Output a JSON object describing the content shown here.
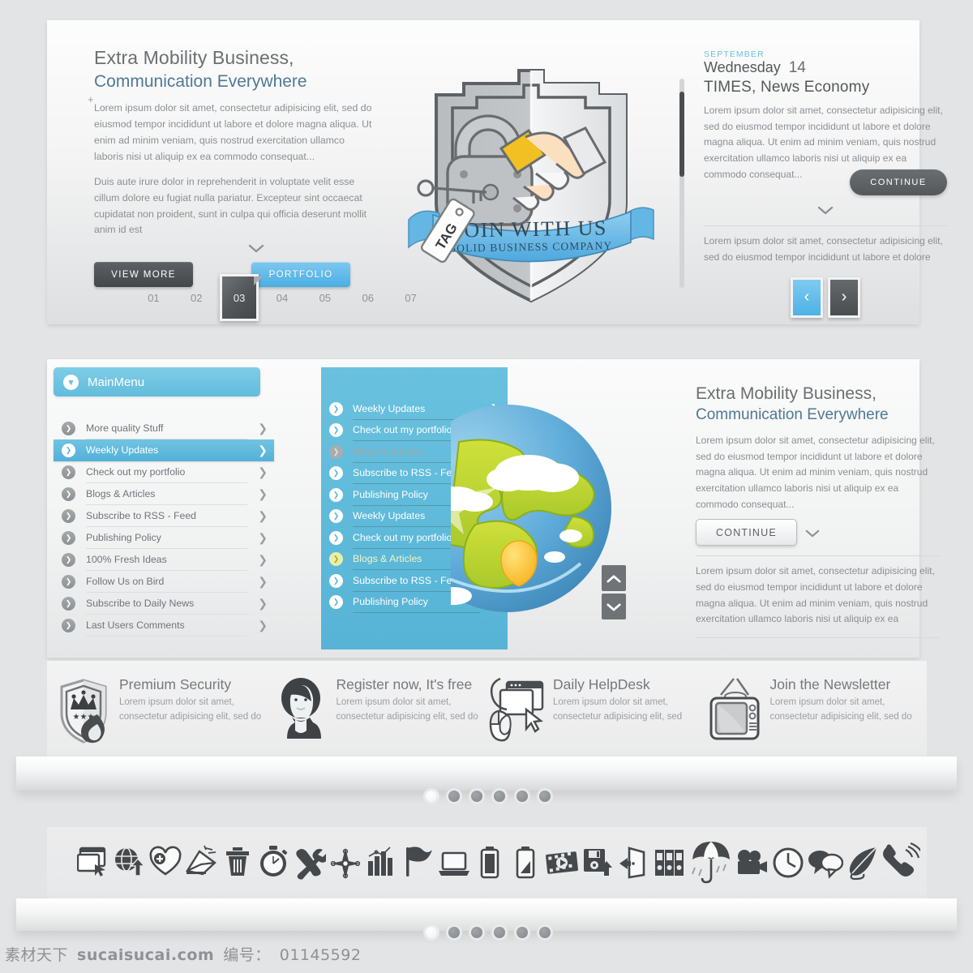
{
  "hero": {
    "title_line1": "Extra Mobility Business,",
    "title_line2": "Communication Everywhere",
    "plus": "+",
    "para1": "Lorem ipsum dolor sit amet, consectetur adipisicing elit, sed do eiusmod tempor incididunt ut labore et dolore magna aliqua. Ut enim ad minim veniam, quis nostrud exercitation ullamco laboris nisi ut aliquip ex ea commodo consequat...",
    "para2": "Duis aute irure dolor in reprehenderit in voluptate velit esse cillum dolore eu fugiat nulla pariatur. Excepteur sint occaecat cupidatat non proident, sunt in culpa qui officia deserunt mollit anim id est",
    "view_more_label": "VIEW MORE",
    "portfolio_label": "PORTFOLIO",
    "carousel": [
      "01",
      "02",
      "03",
      "04",
      "05",
      "06",
      "07"
    ],
    "carousel_active": "03",
    "badge": {
      "ribbon_line1": "JOIN WITH US",
      "ribbon_line2": "SOLID BUSINESS COMPANY",
      "tag_label": "TAG"
    }
  },
  "news": {
    "month": "SEPTEMBER",
    "weekday": "Wednesday",
    "day": "14",
    "headline": "TIMES, News Economy",
    "para": "Lorem ipsum dolor sit amet, consectetur adipisicing elit, sed do eiusmod tempor incididunt ut labore et dolore magna aliqua. Ut enim ad minim veniam, quis nostrud exercitation ullamco laboris nisi ut aliquip ex ea commodo consequat...",
    "continue_label": "CONTINUE",
    "footer_para": "Lorem ipsum dolor sit amet, consectetur adipisicing elit, sed do eiusmod tempor incididunt ut labore et dolore",
    "prev_label": "‹",
    "next_label": "›"
  },
  "menu": {
    "header_label": "MainMenu",
    "items": [
      {
        "label": "More quality Stuff",
        "state": "normal"
      },
      {
        "label": "Weekly Updates",
        "state": "active"
      },
      {
        "label": "Check out my portfolio",
        "state": "normal"
      },
      {
        "label": "Blogs & Articles",
        "state": "normal"
      },
      {
        "label": "Subscribe to RSS - Feed",
        "state": "normal"
      },
      {
        "label": "Publishing Policy",
        "state": "normal"
      },
      {
        "label": "100% Fresh Ideas",
        "state": "normal"
      },
      {
        "label": "Follow Us on Bird",
        "state": "normal"
      },
      {
        "label": "Subscribe to Daily News",
        "state": "normal"
      },
      {
        "label": "Last Users Comments",
        "state": "normal"
      }
    ]
  },
  "submenu": {
    "items": [
      {
        "label": "Weekly Updates",
        "state": "normal"
      },
      {
        "label": "Check out my portfolio",
        "state": "normal"
      },
      {
        "label": "Blogs & Articles",
        "state": "dim"
      },
      {
        "label": "Subscribe to RSS - Feed",
        "state": "normal"
      },
      {
        "label": "Publishing Policy",
        "state": "normal"
      },
      {
        "label": "Weekly Updates",
        "state": "normal"
      },
      {
        "label": "Check out my portfolio",
        "state": "normal"
      },
      {
        "label": "Blogs & Articles",
        "state": "highlight"
      },
      {
        "label": "Subscribe to RSS - Feed",
        "state": "normal"
      },
      {
        "label": "Publishing Policy",
        "state": "normal"
      }
    ]
  },
  "menu_right": {
    "title_line1": "Extra Mobility Business,",
    "title_line2": "Communication Everywhere",
    "para1": "Lorem ipsum dolor sit amet, consectetur adipisicing elit, sed do eiusmod tempor incididunt ut labore et dolore magna aliqua. Ut enim ad minim veniam, quis nostrud exercitation ullamco laboris nisi ut aliquip ex ea commodo consequat...",
    "continue_label": "CONTINUE",
    "para2": "Lorem ipsum dolor sit amet, consectetur adipisicing elit, sed do eiusmod tempor incididunt ut labore et dolore magna aliqua. Ut enim ad minim veniam, quis nostrud exercitation ullamco laboris nisi ut aliquip ex ea"
  },
  "features": [
    {
      "icon": "shield-crown-flame-icon",
      "title": "Premium Security",
      "desc": "Lorem ipsum dolor sit amet, consectetur adipisicing elit, sed do"
    },
    {
      "icon": "user-avatar-icon",
      "title": "Register now, It's free",
      "desc": "Lorem ipsum dolor sit amet, consectetur adipisicing elit, sed do"
    },
    {
      "icon": "mouse-cursor-window-icon",
      "title": "Daily HelpDesk",
      "desc": "Lorem ipsum dolor sit amet, consectetur adipisicing elit, sed"
    },
    {
      "icon": "retro-tv-icon",
      "title": "Join the Newsletter",
      "desc": "Lorem ipsum dolor sit amet, consectetur adipisicing elit, sed do"
    }
  ],
  "pagination": {
    "count": 6,
    "active_index": 0
  },
  "icon_strip": [
    "browser-window-cursor-icon",
    "globe-upload-icon",
    "heart-plus-icon",
    "open-envelope-icon",
    "trash-bin-icon",
    "stopwatch-icon",
    "tools-wrench-screwdriver-icon",
    "compass-icon",
    "bar-chart-icon",
    "flag-icon",
    "laptop-icon",
    "battery-icon",
    "battery-low-icon",
    "film-strip-play-icon",
    "floppy-save-icon",
    "exit-door-icon",
    "binders-icon",
    "umbrella-rain-icon",
    "movie-camera-icon",
    "clock-icon",
    "speech-bubbles-icon",
    "feather-quill-icon",
    "ringing-phone-icon"
  ],
  "watermark": {
    "brand_cn": "素材天下",
    "site": "sucaisucai.com",
    "id_label": "编号：",
    "id_value": "01145592"
  },
  "colors": {
    "accent_blue": "#5cb6da",
    "button_blue": "#4aafe4",
    "dark_gray": "#55585b",
    "text_gray": "#8b8f93",
    "heading_blue": "#4e7a93"
  }
}
